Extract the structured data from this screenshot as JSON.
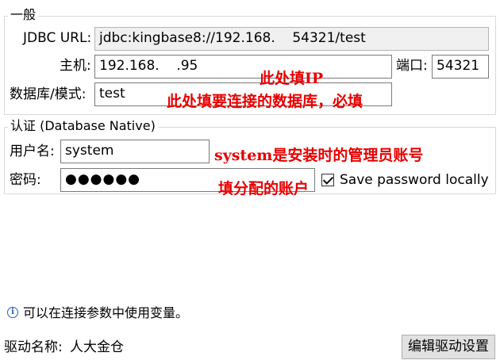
{
  "general": {
    "legend": "一般",
    "jdbc_url_label": "JDBC URL:",
    "jdbc_url_value": "jdbc:kingbase8://192.168.    54321/test",
    "host_label": "主机:",
    "host_value": "192.168.    .95",
    "port_label": "端口:",
    "port_value": "54321",
    "database_label": "数据库/模式:",
    "database_value": "test"
  },
  "auth": {
    "legend": "认证 (Database Native)",
    "username_label": "用户名:",
    "username_value": "system",
    "password_label": "密码:",
    "password_value": "●●●●●●",
    "save_password_label": "Save password locally",
    "save_password_checked": true
  },
  "annotations": {
    "host_note": "此处填IP",
    "database_note": "此处填要连接的数据库，必填",
    "username_note": "system是安装时的管理员账号",
    "password_note": "填分配的账户"
  },
  "footer": {
    "info_text": "可以在连接参数中使用变量。",
    "driver_label": "驱动名称:",
    "driver_value": "人大金仓",
    "edit_driver_button": "编辑驱动设置"
  },
  "icons": {
    "info": "info-icon",
    "checkbox": "checkbox-icon"
  },
  "colors": {
    "annotation": "#e60000",
    "info": "#1f5fbf"
  }
}
